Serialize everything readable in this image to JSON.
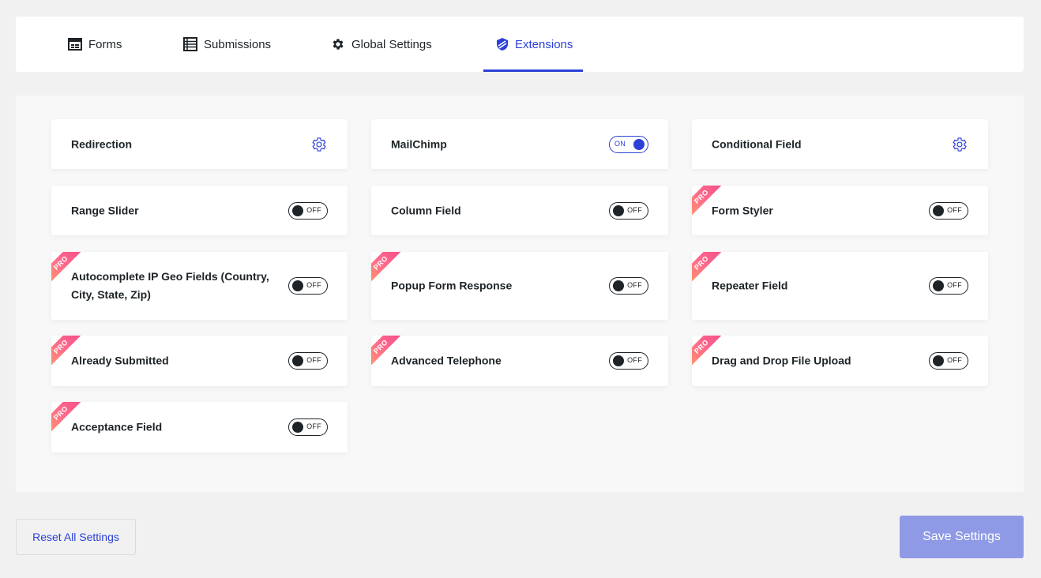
{
  "tabs": {
    "forms": "Forms",
    "submissions": "Submissions",
    "global_settings": "Global Settings",
    "extensions": "Extensions"
  },
  "colors": {
    "accent": "#2b40d6",
    "save_button": "#8f9ae6",
    "pro_ribbon": "#f0458a"
  },
  "extensions": [
    {
      "label": "Redirection",
      "control": "gear",
      "pro": false
    },
    {
      "label": "MailChimp",
      "control": "toggle",
      "state": "ON",
      "pro": false
    },
    {
      "label": "Conditional Field",
      "control": "gear",
      "pro": false
    },
    {
      "label": "Range Slider",
      "control": "toggle",
      "state": "OFF",
      "pro": false
    },
    {
      "label": "Column Field",
      "control": "toggle",
      "state": "OFF",
      "pro": false
    },
    {
      "label": "Form Styler",
      "control": "toggle",
      "state": "OFF",
      "pro": true
    },
    {
      "label": "Autocomplete IP Geo Fields (Country, City, State, Zip)",
      "control": "toggle",
      "state": "OFF",
      "pro": true
    },
    {
      "label": "Popup Form Response",
      "control": "toggle",
      "state": "OFF",
      "pro": true
    },
    {
      "label": "Repeater Field",
      "control": "toggle",
      "state": "OFF",
      "pro": true
    },
    {
      "label": "Already Submitted",
      "control": "toggle",
      "state": "OFF",
      "pro": true
    },
    {
      "label": "Advanced Telephone",
      "control": "toggle",
      "state": "OFF",
      "pro": true
    },
    {
      "label": "Drag and Drop File Upload",
      "control": "toggle",
      "state": "OFF",
      "pro": true
    },
    {
      "label": "Acceptance Field",
      "control": "toggle",
      "state": "OFF",
      "pro": true
    }
  ],
  "pro_label": "PRO",
  "footer": {
    "reset_label": "Reset All Settings",
    "save_label": "Save Settings"
  }
}
